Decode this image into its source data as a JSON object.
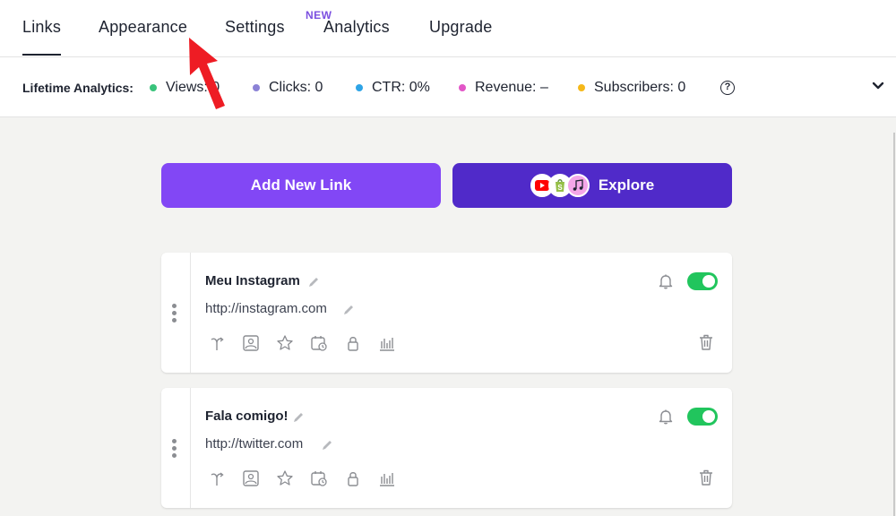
{
  "tabs": [
    {
      "label": "Links",
      "active": true
    },
    {
      "label": "Appearance",
      "active": false
    },
    {
      "label": "Settings",
      "active": false
    },
    {
      "label": "Analytics",
      "active": false,
      "badge": "NEW"
    },
    {
      "label": "Upgrade",
      "active": false
    }
  ],
  "analytics": {
    "title": "Lifetime Analytics:",
    "stats": [
      {
        "label": "Views: 0",
        "color": "#39c37b"
      },
      {
        "label": "Clicks: 0",
        "color": "#8b82d6"
      },
      {
        "label": "CTR: 0%",
        "color": "#2ea4e6"
      },
      {
        "label": "Revenue: –",
        "color": "#e256c7"
      },
      {
        "label": "Subscribers: 0",
        "color": "#f5b81a"
      }
    ],
    "help_icon": "question-circle-icon",
    "expand_icon": "chevron-down-icon"
  },
  "actions": {
    "add_label": "Add New Link",
    "explore_label": "Explore",
    "explore_icons": [
      "youtube-icon",
      "shopify-icon",
      "music-icon"
    ]
  },
  "links": [
    {
      "title": "Meu Instagram",
      "url": "http://instagram.com",
      "enabled": true
    },
    {
      "title": "Fala comigo!",
      "url": "http://twitter.com",
      "enabled": true
    }
  ],
  "colors": {
    "primary": "#8247f5",
    "explore": "#502ac9",
    "toggle_on": "#21c55d",
    "annotation_arrow": "#ee1c24"
  }
}
